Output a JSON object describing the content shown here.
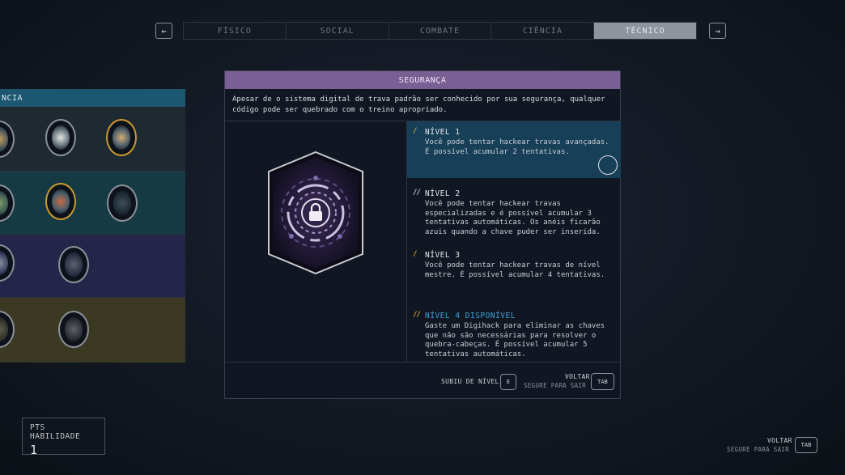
{
  "nav": {
    "prev_glyph": "←",
    "next_glyph": "→"
  },
  "tabs": [
    {
      "label": "FÍSICO"
    },
    {
      "label": "SOCIAL"
    },
    {
      "label": "COMBATE"
    },
    {
      "label": "CIÊNCIA"
    },
    {
      "label": "TÉCNICO",
      "active": true
    }
  ],
  "tree": {
    "header": "NCIA"
  },
  "panel": {
    "title": "SEGURANÇA",
    "description": "Apesar de o sistema digital de trava padrão ser conhecido por sua segurança, qualquer código pode ser quebrado com o treino apropriado.",
    "ranks": [
      {
        "bars": "/",
        "title": "NÍVEL 1",
        "text": "Você pode tentar hackear travas avançadas. É possível acumular 2 tentativas.",
        "active": true
      },
      {
        "bars": "//",
        "title": "NÍVEL 2",
        "text": "Você pode tentar hackear travas especializadas e é possível acumular 3 tentativas automáticas. Os anéis ficarão azuis quando a chave puder ser inserida."
      },
      {
        "bars": "/",
        "title": "NÍVEL 3",
        "text": "Você pode tentar hackear travas de nível mestre. É possível acumular 4 tentativas."
      },
      {
        "bars": "//",
        "title": "NÍVEL 4 DISPONÍVEL",
        "text": "Gaste um Digihack para eliminar as chaves que não são necessárias para resolver o quebra-cabeças. É possível acumular 5 tentativas automáticas.",
        "available": true
      }
    ],
    "footer": {
      "rankup_label": "SUBIU DE NÍVEL",
      "rankup_key": "E",
      "back_label": "VOLTAR",
      "back_sub": "SEGURE PARA SAIR",
      "back_key": "TAB"
    }
  },
  "skill_points": {
    "label": "PTS HABILIDADE",
    "value": "1"
  },
  "bottom_right": {
    "back_label": "VOLTAR",
    "back_sub": "SEGURE PARA SAIR",
    "back_key": "TAB"
  },
  "colors": {
    "panel_title": "#7a5f94",
    "active_rank": "#173f58",
    "available_rank": "#3aa2d8",
    "bar_accent": "#d9a325"
  }
}
